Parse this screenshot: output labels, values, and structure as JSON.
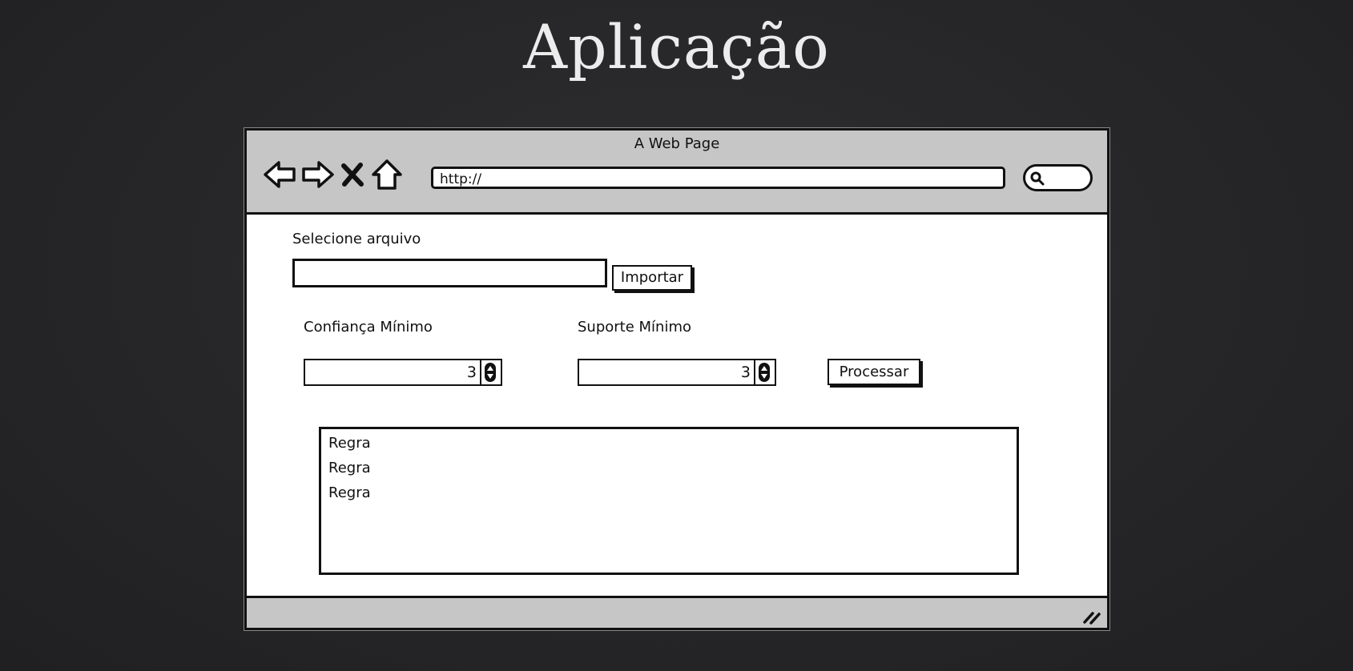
{
  "slide": {
    "title": "Aplicação"
  },
  "browser": {
    "window_title": "A Web Page",
    "url": "http://",
    "nav_icons": [
      "back-arrow-icon",
      "forward-arrow-icon",
      "stop-icon",
      "home-icon"
    ],
    "search_icon": "search-icon"
  },
  "form": {
    "file_label": "Selecione arquivo",
    "file_value": "",
    "import_label": "Importar",
    "confidence_label": "Confiança Mínimo",
    "confidence_value": "3",
    "support_label": "Suporte Mínimo",
    "support_value": "3",
    "process_label": "Processar"
  },
  "results": {
    "items": [
      {
        "label": "Regra"
      },
      {
        "label": "Regra"
      },
      {
        "label": "Regra"
      }
    ]
  },
  "colors": {
    "background": "#262628",
    "chrome": "#c6c6c6",
    "ink": "#111111",
    "title": "#ececec"
  }
}
